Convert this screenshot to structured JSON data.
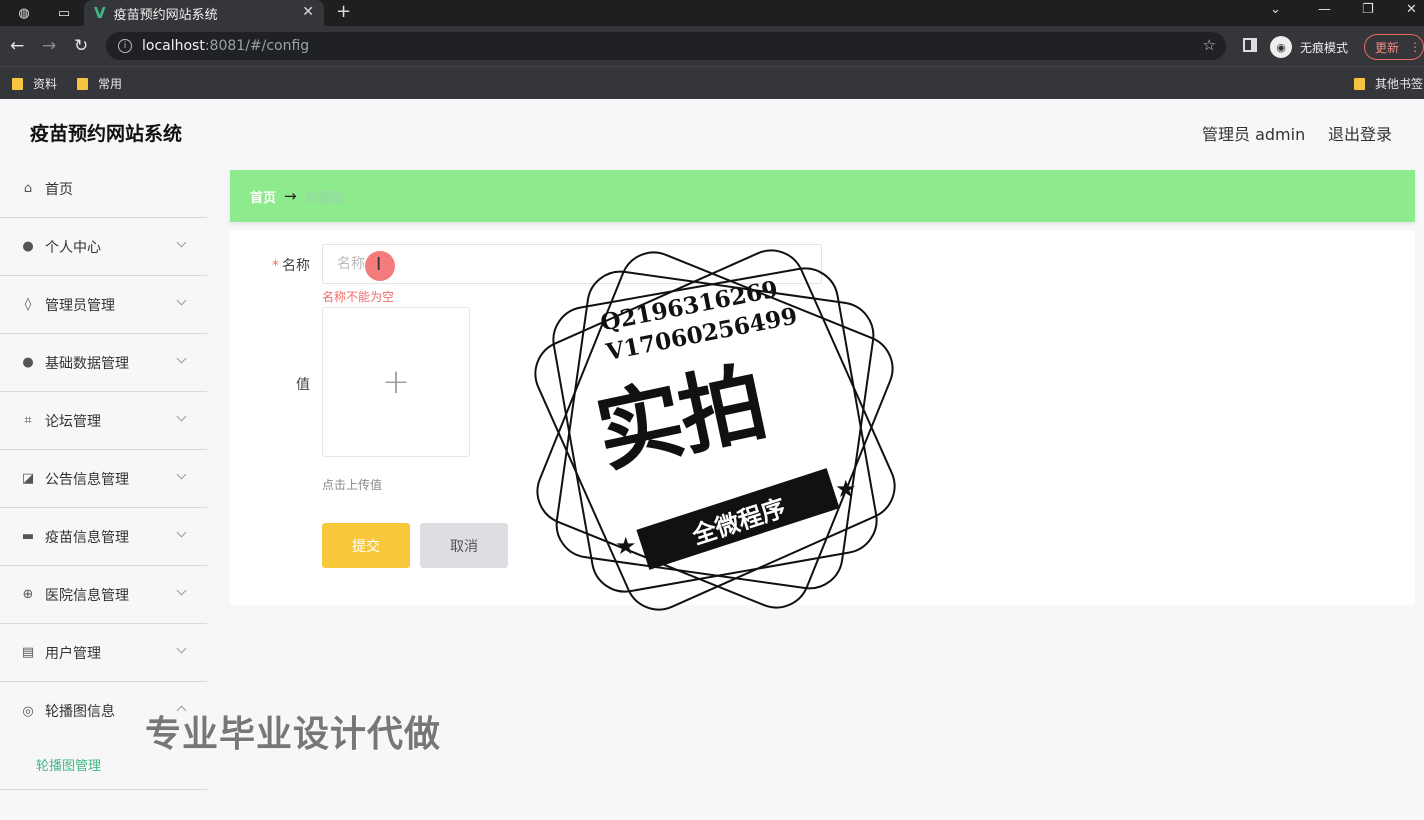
{
  "browser": {
    "tab_title": "疫苗预约网站系统",
    "url_host": "localhost",
    "url_path": ":8081/#/config",
    "incognito_label": "无痕模式",
    "update_label": "更新",
    "bookmarks": [
      "资料",
      "常用"
    ],
    "other_bookmarks": "其他书签"
  },
  "app": {
    "title": "疫苗预约网站系统",
    "user_label": "管理员 admin",
    "logout_label": "退出登录"
  },
  "sidebar": {
    "items": [
      {
        "label": "首页"
      },
      {
        "label": "个人中心"
      },
      {
        "label": "管理员管理"
      },
      {
        "label": "基础数据管理"
      },
      {
        "label": "论坛管理"
      },
      {
        "label": "公告信息管理"
      },
      {
        "label": "疫苗信息管理"
      },
      {
        "label": "医院信息管理"
      },
      {
        "label": "用户管理"
      },
      {
        "label": "轮播图信息"
      }
    ],
    "sub_item": "轮播图管理"
  },
  "breadcrumb": {
    "home": "首页",
    "separator": "→",
    "current": "轮播图"
  },
  "form": {
    "name_label": "名称",
    "name_placeholder": "名称",
    "name_error": "名称不能为空",
    "value_label": "值",
    "upload_hint": "点击上传值",
    "submit_label": "提交",
    "cancel_label": "取消"
  },
  "watermark": {
    "qq": "Q2196316269",
    "vx": "V17060256499",
    "big": "实拍",
    "ribbon": "全微程序",
    "promo": "专业毕业设计代做"
  },
  "colors": {
    "breadcrumb_bg": "#8deb8d",
    "submit_bg": "#f7c83b",
    "accent": "#41b883",
    "error": "#f56c6c"
  }
}
